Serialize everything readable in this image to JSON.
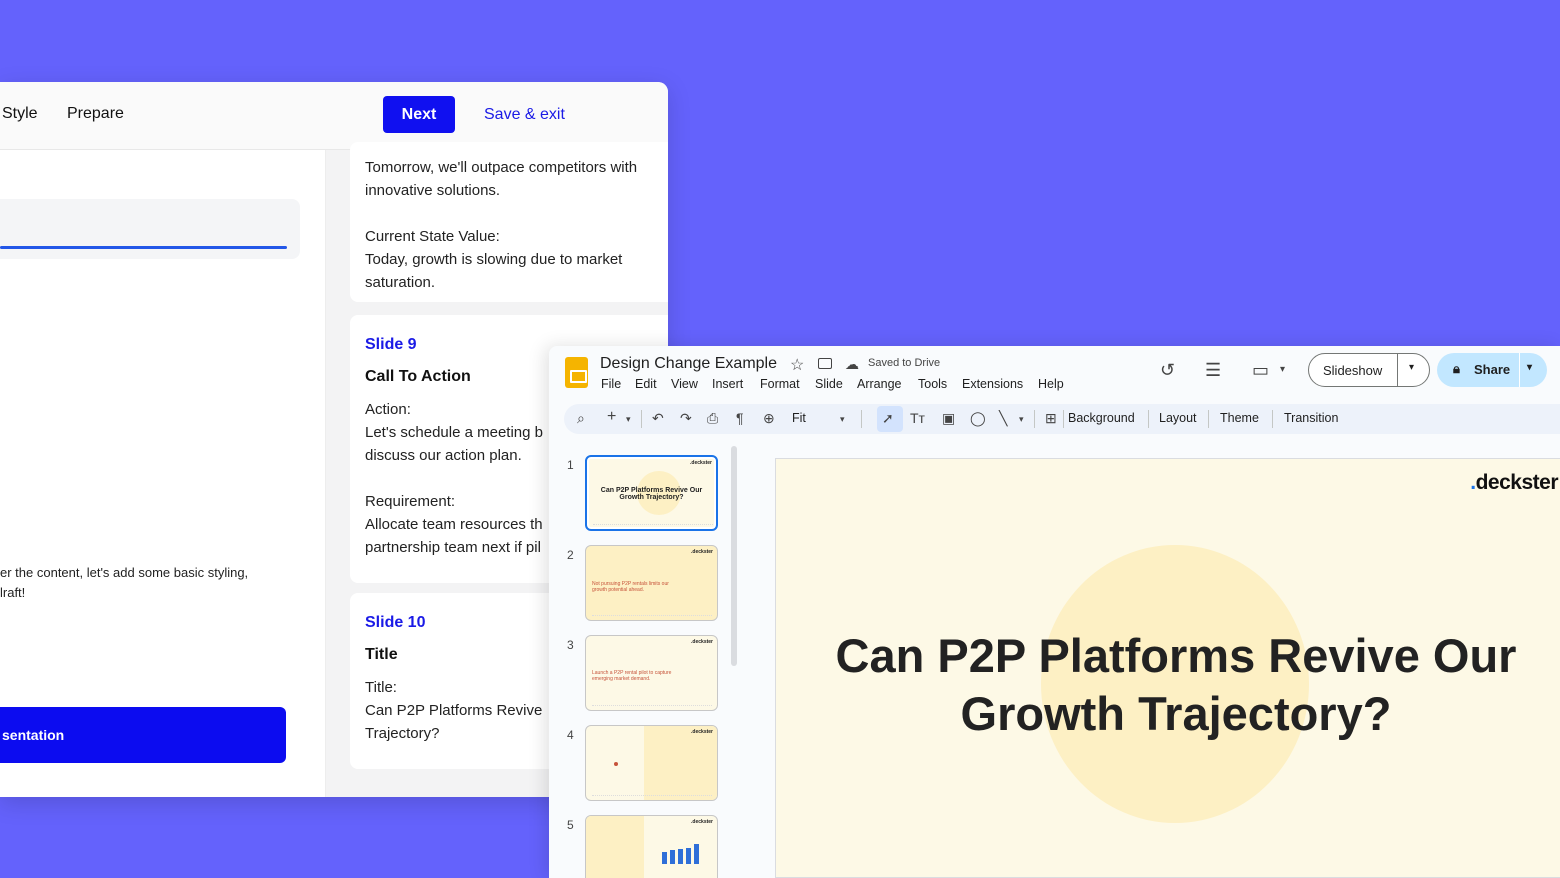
{
  "editor": {
    "tabs": [
      "Style",
      "Prepare"
    ],
    "next_label": "Next",
    "save_exit_label": "Save & exit",
    "helper_text": "er the content, let's add some basic styling,\nlraft!",
    "present_button_label": "sentation",
    "cards": [
      {
        "body": "Tomorrow, we'll outpace competitors with\ninnovative solutions.\n\nCurrent State Value:\nToday, growth is slowing due to market\nsaturation."
      },
      {
        "slide_no": "Slide 9",
        "title": "Call To Action",
        "body": "Action:\nLet's schedule a meeting b\ndiscuss our action plan.\n\nRequirement:\nAllocate team resources th\npartnership team next if pil"
      },
      {
        "slide_no": "Slide 10",
        "title": "Title",
        "body": "Title:\nCan P2P Platforms Revive\nTrajectory?"
      }
    ]
  },
  "slides_app": {
    "doc_title": "Design Change Example",
    "saved_status": "Saved to Drive",
    "menu": [
      "File",
      "Edit",
      "View",
      "Insert",
      "Format",
      "Slide",
      "Arrange",
      "Tools",
      "Extensions",
      "Help"
    ],
    "slideshow_label": "Slideshow",
    "share_label": "Share",
    "zoom": "Fit",
    "toolbar_text": {
      "background": "Background",
      "layout": "Layout",
      "theme": "Theme",
      "transition": "Transition"
    },
    "thumbnails": [
      {
        "number": "1",
        "logo": ".deckster",
        "title": "Can P2P Platforms Revive Our Growth Trajectory?"
      },
      {
        "number": "2",
        "logo": ".deckster",
        "line1": "Not pursuing P2P rentals limits our",
        "line2": "growth potential ahead."
      },
      {
        "number": "3",
        "logo": ".deckster",
        "line1": "Launch a P2P rental pilot to capture",
        "line2": "emerging market demand."
      },
      {
        "number": "4",
        "logo": ".deckster"
      },
      {
        "number": "5",
        "logo": ".deckster"
      }
    ],
    "canvas": {
      "logo_prefix": ".",
      "logo_name": "deckster",
      "title": "Can P2P Platforms Revive Our Growth Trajectory?"
    }
  }
}
